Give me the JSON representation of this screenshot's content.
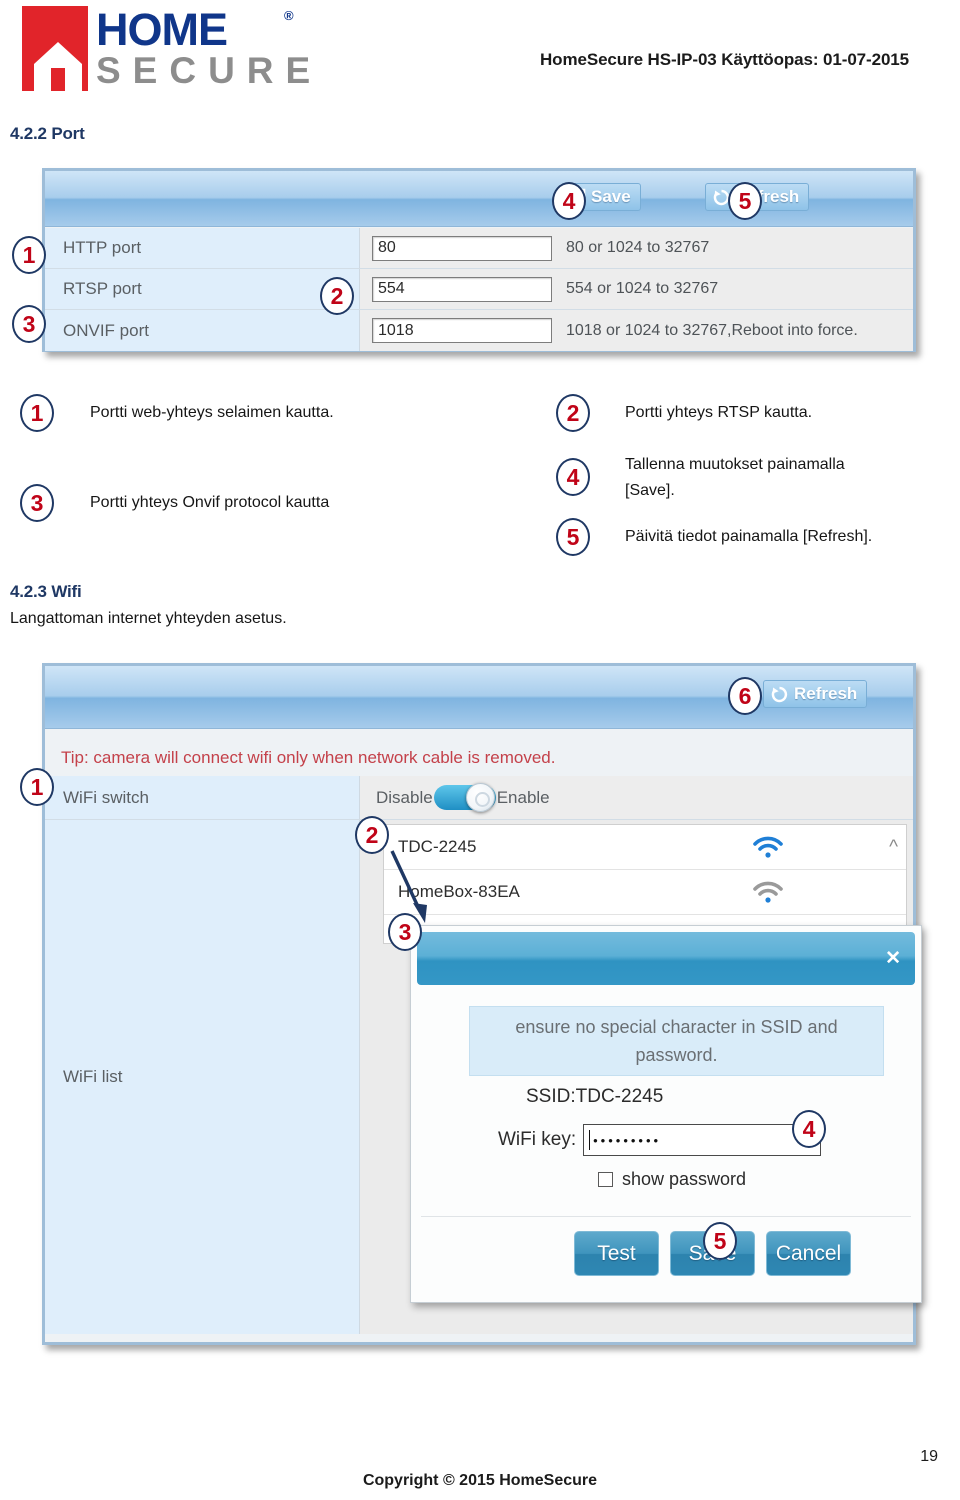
{
  "header": {
    "logo_home": "HOME",
    "logo_registered": "®",
    "logo_secure": "SECURE",
    "title": "HomeSecure HS-IP-03 Käyttöopas: 01-07-2015"
  },
  "sections": {
    "port": {
      "heading": "4.2.2 Port"
    },
    "wifi": {
      "heading": "4.2.3 Wifi",
      "subtitle": "Langattoman internet yhteyden asetus."
    }
  },
  "port_panel": {
    "toolbar": {
      "save_label": "Save",
      "save_icon": "floppy-disk-icon",
      "save_badge": "4",
      "refresh_label": "Refresh",
      "refresh_icon": "refresh-circular-arrows-icon",
      "refresh_badge": "5"
    },
    "rows": [
      {
        "badge": "1",
        "label": "HTTP port",
        "value": "80",
        "hint": "80 or 1024 to 32767"
      },
      {
        "badge": "2",
        "label": "RTSP port",
        "value": "554",
        "hint": "554 or 1024 to 32767"
      },
      {
        "badge": "3",
        "label": "ONVIF port",
        "value": "1018",
        "hint": "1018 or 1024 to 32767,Reboot into force."
      }
    ]
  },
  "port_legend": [
    {
      "badge": "1",
      "text": "Portti web-yhteys selaimen kautta."
    },
    {
      "badge": "2",
      "text": "Portti yhteys RTSP kautta."
    },
    {
      "badge": "3",
      "text": "Portti yhteys Onvif protocol kautta"
    },
    {
      "badge": "4",
      "line1": "Tallenna muutokset painamalla",
      "line2": "[Save]."
    },
    {
      "badge": "5",
      "text": "Päivitä tiedot painamalla [Refresh]."
    }
  ],
  "wifi_panel": {
    "toolbar": {
      "refresh_label": "Refresh",
      "refresh_icon": "refresh-circular-arrows-icon",
      "refresh_badge": "6"
    },
    "tip": "Tip: camera will connect wifi only when network cable is removed.",
    "switch_row": {
      "badge": "1",
      "label": "WiFi switch",
      "off_label": "Disable",
      "on_label": "Enable",
      "state": "enabled"
    },
    "list_row": {
      "badge": "2",
      "label": "WiFi list",
      "scroll_icon": "chevron-up-icon",
      "networks": [
        {
          "ssid": "TDC-2245",
          "signal_icon": "wifi-signal-strong-icon",
          "signal_color": "#1f7fd6"
        },
        {
          "ssid": "HomeBox-83EA",
          "signal_icon": "wifi-signal-weak-icon",
          "signal_color": "#9a9a9a"
        }
      ]
    },
    "dialog": {
      "badge": "3",
      "close_icon": "close-x-icon",
      "note_line1": "ensure no special character in SSID and",
      "note_line2": "password.",
      "ssid_text": "SSID:TDC-2245",
      "key_label": "WiFi key:",
      "key_value": "•••••••••",
      "key_badge": "4",
      "show_password_label": "show password",
      "show_password_checked": false,
      "buttons": [
        {
          "label": "Test",
          "badge": null
        },
        {
          "label": "Save",
          "badge": "5"
        },
        {
          "label": "Cancel",
          "badge": null
        }
      ]
    }
  },
  "footer": {
    "copyright": "Copyright © 2015 HomeSecure",
    "page_number": "19"
  },
  "colors": {
    "brand_red": "#e1242a",
    "brand_blue": "#10368a",
    "heading_blue": "#1f3864",
    "badge_red": "#c00418",
    "tip_red": "#c4414a"
  }
}
